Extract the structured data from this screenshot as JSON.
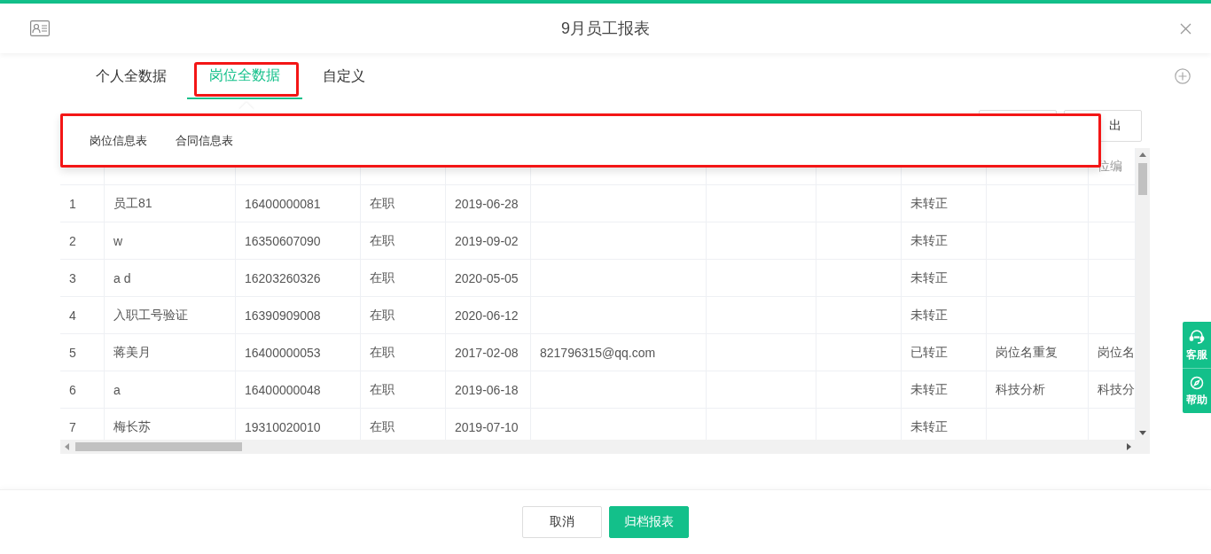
{
  "window": {
    "title": "9月员工报表"
  },
  "tabs": [
    {
      "label": "个人全数据",
      "selected": false
    },
    {
      "label": "岗位全数据",
      "selected": true
    },
    {
      "label": "自定义",
      "selected": false
    }
  ],
  "dropdown": {
    "items": [
      {
        "label": "岗位信息表"
      },
      {
        "label": "合同信息表"
      }
    ]
  },
  "toolbar": {
    "export_button": "出"
  },
  "table": {
    "header_column_11": "位编",
    "rows": [
      {
        "no": "1",
        "name": "员工81",
        "phone": "16400000081",
        "status": "在职",
        "hire_date": "2019-06-28",
        "column_9": "未转正"
      },
      {
        "no": "2",
        "name": "w",
        "phone": "16350607090",
        "status": "在职",
        "hire_date": "2019-09-02",
        "column_9": "未转正"
      },
      {
        "no": "3",
        "name": "a d",
        "phone": "16203260326",
        "status": "在职",
        "hire_date": "2020-05-05",
        "column_9": "未转正"
      },
      {
        "no": "4",
        "name": "入职工号验证",
        "phone": "16390909008",
        "status": "在职",
        "hire_date": "2020-06-12",
        "column_9": "未转正"
      },
      {
        "no": "5",
        "name": "蒋美月",
        "phone": "16400000053",
        "status": "在职",
        "hire_date": "2017-02-08",
        "email": "821796315@qq.com",
        "column_9": "已转正",
        "column_10": "岗位名重复",
        "column_11": "岗位名"
      },
      {
        "no": "6",
        "name": "a",
        "phone": "16400000048",
        "status": "在职",
        "hire_date": "2019-06-18",
        "column_9": "未转正",
        "column_10": "科技分析",
        "column_11": "科技分"
      },
      {
        "no": "7",
        "name": "梅长苏",
        "phone": "19310020010",
        "status": "在职",
        "hire_date": "2019-07-10",
        "column_9": "未转正"
      }
    ]
  },
  "side_widget": [
    {
      "label": "客服",
      "kind": "headset"
    },
    {
      "label": "帮助",
      "kind": "compass"
    }
  ],
  "footer": {
    "cancel": "取消",
    "submit": "归档报表"
  }
}
